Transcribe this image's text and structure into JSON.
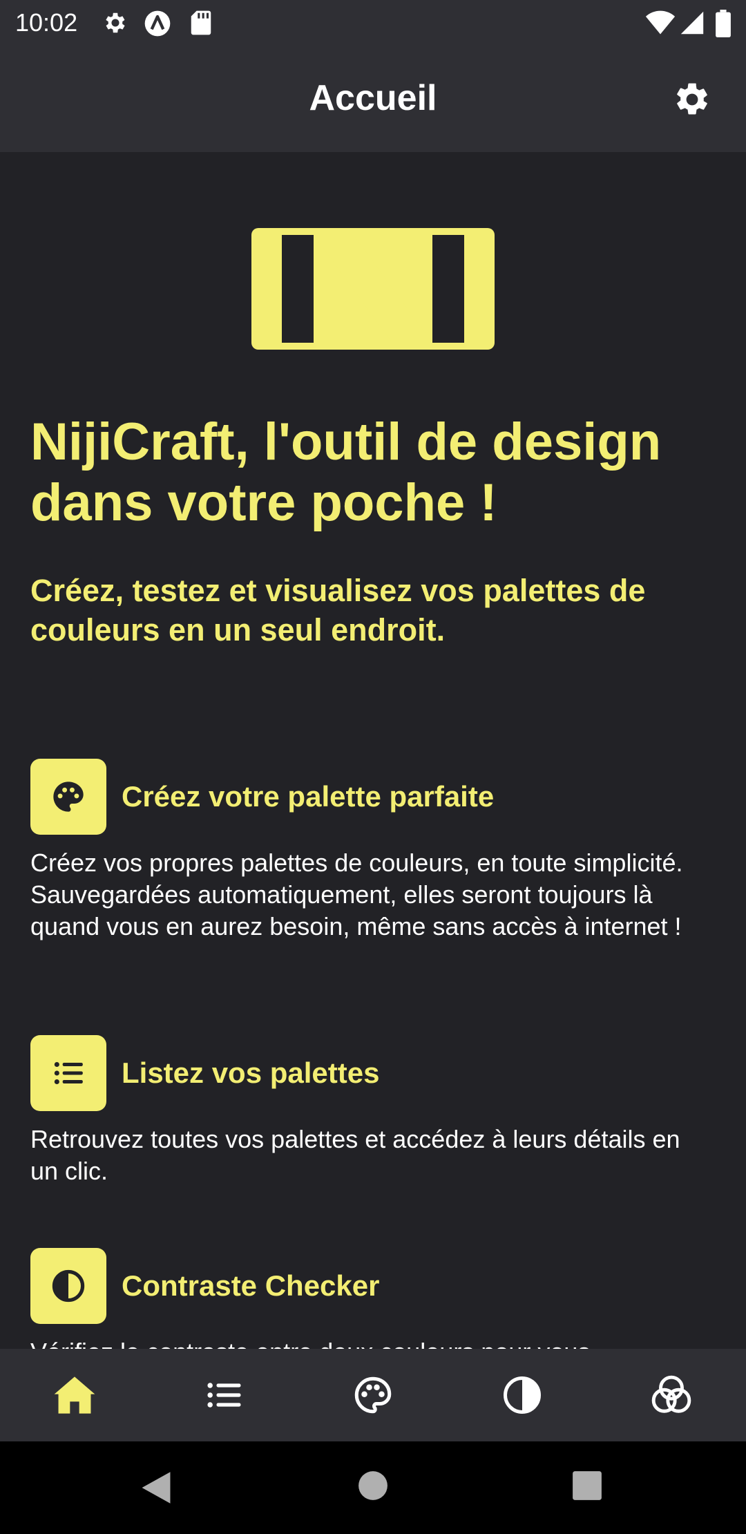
{
  "status_bar": {
    "time": "10:02",
    "left_icons": [
      "gear-icon",
      "a-logo-icon",
      "sd-card-icon"
    ],
    "right_icons": [
      "wifi-icon",
      "signal-icon",
      "battery-icon"
    ]
  },
  "app_bar": {
    "title": "Accueil",
    "settings_icon": "gear-icon"
  },
  "hero": {
    "logo_icon": "nijicraft-logo-icon",
    "title": "NijiCraft, l'outil de design dans votre poche !",
    "subtitle": "Créez, testez et visualisez vos palettes de couleurs en un seul endroit."
  },
  "features": [
    {
      "icon": "palette-icon",
      "title": "Créez votre palette parfaite",
      "description": "Créez vos propres palettes de couleurs, en toute simplicité. Sauvegardées automatiquement, elles seront toujours là quand vous en aurez besoin, même sans accès à internet !"
    },
    {
      "icon": "list-icon",
      "title": "Listez vos palettes",
      "description": "Retrouvez toutes vos palettes et accédez à leurs détails en un clic."
    },
    {
      "icon": "contrast-icon",
      "title": "Contraste Checker",
      "description": "Vérifiez le contraste entre deux couleurs pour vous"
    }
  ],
  "bottom_nav": {
    "items": [
      "home-icon",
      "list-icon",
      "palette-icon",
      "contrast-icon",
      "color-blend-icon"
    ],
    "active_index": 0
  },
  "colors": {
    "background": "#222226",
    "bar": "#2f2f34",
    "accent": "#f3ee73",
    "text": "#ffffff",
    "inactive_nav": "#ffffff"
  }
}
